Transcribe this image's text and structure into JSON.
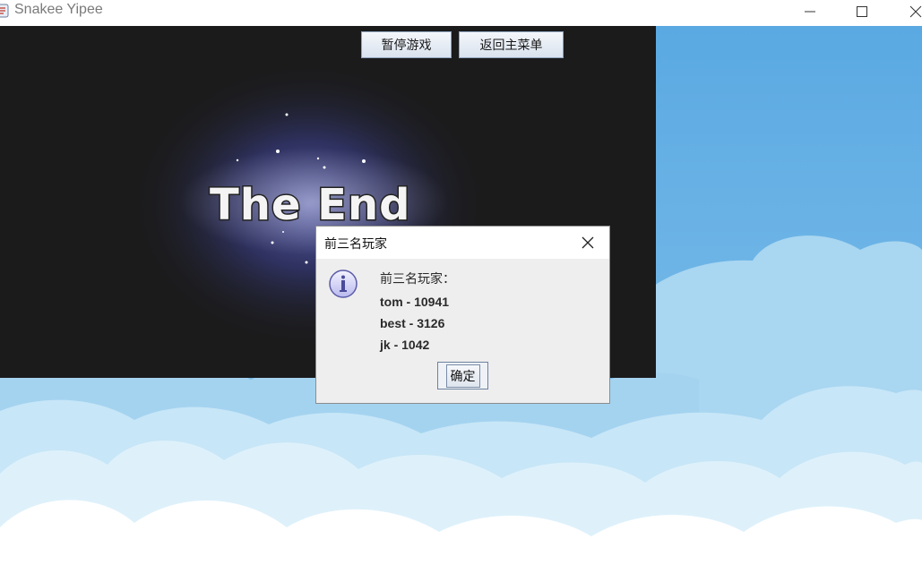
{
  "window": {
    "title": "Snakee Yipee"
  },
  "game": {
    "pause_button": "暂停游戏",
    "menu_button": "返回主菜单",
    "end_text": "The End"
  },
  "dialog": {
    "title": "前三名玩家",
    "heading": "前三名玩家：",
    "lines": [
      "tom - 10941",
      "best - 3126",
      "jk - 1042"
    ],
    "ok_label": "确定"
  },
  "colors": {
    "sky": "#6ab2e4",
    "cloud": "#ffffff",
    "game_bg": "#1b1b1c"
  },
  "icons": [
    "java-app-icon",
    "minimize-icon",
    "maximize-icon",
    "close-icon",
    "info-icon"
  ]
}
